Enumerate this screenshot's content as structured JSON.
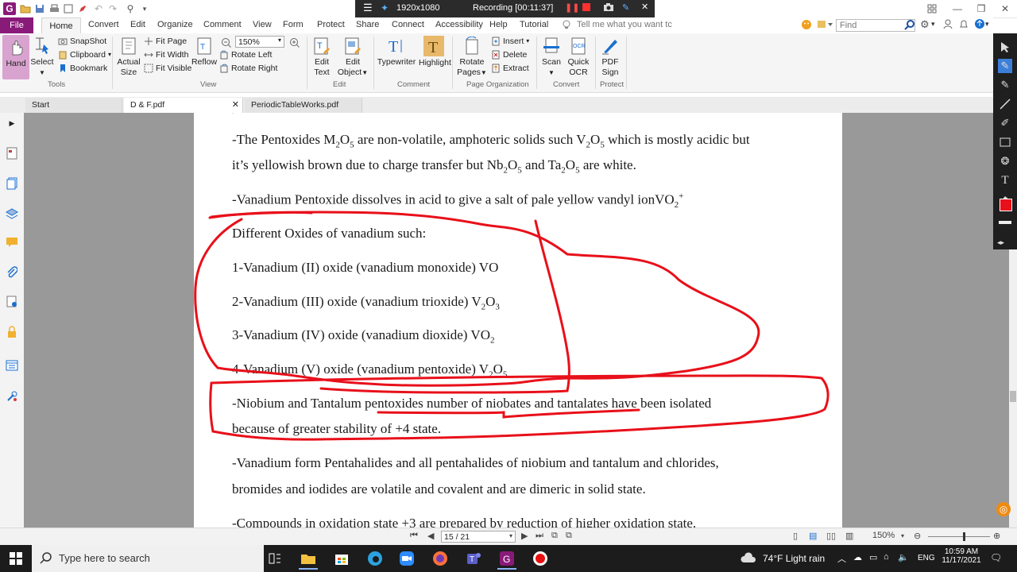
{
  "title_bar": {
    "recording_resolution": "1920x1080",
    "recording_status": "Recording [00:11:37]"
  },
  "menu": {
    "file": "File",
    "tabs": [
      "Home",
      "Convert",
      "Edit",
      "Organize",
      "Comment",
      "View",
      "Form",
      "Protect",
      "Share",
      "Connect",
      "Accessibility",
      "Help",
      "Tutorial"
    ],
    "tell_me": "Tell me what you want tc",
    "find_placeholder": "Find"
  },
  "ribbon": {
    "hand": "Hand",
    "select": "Select",
    "snapshot": "SnapShot",
    "clipboard": "Clipboard",
    "bookmark": "Bookmark",
    "actual_size_1": "Actual",
    "actual_size_2": "Size",
    "fit_page": "Fit Page",
    "fit_width": "Fit Width",
    "fit_visible": "Fit Visible",
    "reflow": "Reflow",
    "zoom_value": "150%",
    "rotate_left": "Rotate Left",
    "rotate_right": "Rotate Right",
    "edit_text_1": "Edit",
    "edit_text_2": "Text",
    "edit_object_1": "Edit",
    "edit_object_2": "Object",
    "typewriter": "Typewriter",
    "highlight": "Highlight",
    "rotate_pages_1": "Rotate",
    "rotate_pages_2": "Pages",
    "insert": "Insert",
    "delete": "Delete",
    "extract": "Extract",
    "scan": "Scan",
    "quick_ocr_1": "Quick",
    "quick_ocr_2": "OCR",
    "pdf_sign_1": "PDF",
    "pdf_sign_2": "Sign",
    "groups": {
      "tools": "Tools",
      "view": "View",
      "edit": "Edit",
      "comment": "Comment",
      "page_org": "Page Organization",
      "convert": "Convert",
      "protect": "Protect"
    }
  },
  "doc_tabs": [
    "Start",
    "D & F.pdf",
    "PeriodicTableWorks.pdf"
  ],
  "document": {
    "p1a_pre": "-The Pentoxides M",
    "p1a_s1": "2",
    "p1a_m1": "O",
    "p1a_s2": "5",
    "p1a_m2": " are non-volatile, amphoteric solids such V",
    "p1a_s3": "2",
    "p1a_m3": "O",
    "p1a_s4": "5",
    "p1a_post": " which is mostly acidic but",
    "p1b_pre": "it’s yellowish brown due to charge transfer but Nb",
    "p1b_s1": "2",
    "p1b_m1": "O",
    "p1b_s2": "5",
    "p1b_m2": " and Ta",
    "p1b_s3": "2",
    "p1b_m3": "O",
    "p1b_s4": "5",
    "p1b_post": " are white.",
    "p2_pre": "-Vanadium Pentoxide dissolves in acid to give a salt of pale yellow vandyl ionVO",
    "p2_sub": "2",
    "p2_sup": "+",
    "p3": "Different Oxides of vanadium such:",
    "p4": "1-Vanadium (II) oxide (vanadium monoxide) VO",
    "p5_pre": "2-Vanadium (III) oxide (vanadium trioxide) V",
    "p5_s1": "2",
    "p5_m": "O",
    "p5_s2": "3",
    "p6_pre": "3-Vanadium (IV) oxide (vanadium dioxide) VO",
    "p6_s1": "2",
    "p7_pre": "4-Vanadium (V) oxide (vanadium pentoxide) V",
    "p7_s1": "2",
    "p7_m": "O",
    "p7_s2": "5",
    "p8a": "-Niobium and Tantalum pentoxides number of niobates and tantalates have been isolated",
    "p8b": "because of greater stability of +4 state.",
    "p9a": "-Vanadium form Pentahalides and all pentahalides of niobium and tantalum and chlorides,",
    "p9b": "bromides and iodides are volatile and covalent and are dimeric in solid state.",
    "p10": "-Compounds in oxidation state +3 are prepared by reduction of higher oxidation state."
  },
  "status_bar": {
    "page_indicator": "15 / 21",
    "zoom": "150%"
  },
  "taskbar": {
    "search_placeholder": "Type here to search",
    "weather": "74°F  Light rain",
    "language": "ENG",
    "time": "10:59 AM",
    "date": "11/17/2021"
  },
  "colors": {
    "accent": "#8a1a7a",
    "annotation": "#e8101a",
    "highlight_btn": "#e8b96a"
  }
}
